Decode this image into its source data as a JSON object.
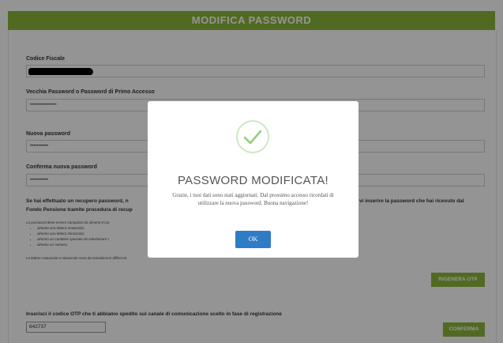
{
  "header": {
    "title": "MODIFICA PASSWORD"
  },
  "form": {
    "codice_fiscale_label": "Codice Fiscale",
    "vecchia_password_label": "Vecchia Password o Password di Primo Accesso",
    "vecchia_password_value": "••••••••••••••••",
    "nuova_password_label": "Nuova password",
    "nuova_password_value": "•••••••••••",
    "conferma_password_label": "Conferma nuova password",
    "conferma_password_value": "•••••••••••",
    "info_left": "Se hai effettuato un recupero password, n Fondo Pensione tramite procedura di recup",
    "info_right": "vi inserire la password che hai ricevuto dal",
    "rules_intro": "La password deve essere composta da almeno 8 car",
    "rules": [
      "almeno una lettera maiuscola;",
      "almeno una lettera minuscola;",
      "almeno un carattere speciale da selezionare t",
      "almeno un numero;"
    ],
    "rules_note": "Le lettere maiuscole e minuscole sono da considerarsi differenti.",
    "rigenera_label": "RIGENERA OTP",
    "otp_label": "Inserisci il codice OTP che ti abbiamo spedito sul canale di comunicazione scelto in fase di registrazione",
    "otp_value": "642737",
    "conferma_label": "CONFERMA"
  },
  "modal": {
    "icon": "checkmark-icon",
    "title": "PASSWORD MODIFICATA!",
    "message": "Grazie, i tuoi dati sono stati aggiornati. Dal prossimo accesso ricordati di utilizzare la nuova password. Buona navigazione!",
    "ok_label": "OK"
  },
  "colors": {
    "accent_green": "#8cb73c",
    "ok_blue": "#2f7cc6",
    "check_green": "#8fcf7a"
  }
}
